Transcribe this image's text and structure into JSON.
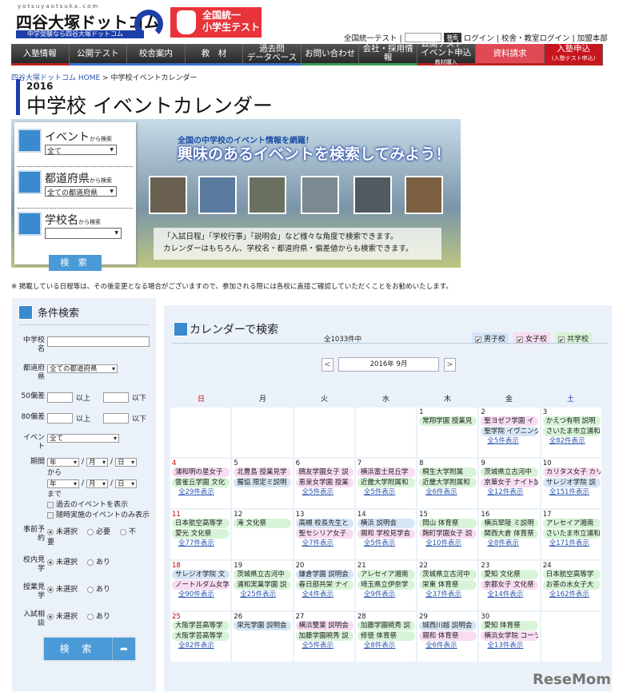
{
  "header": {
    "logo_url": "yotsuyaotsuka.com",
    "logo_text": "四谷大塚ドットコム",
    "logo_tagline": "中学受験なら四谷大塚ドットコム",
    "banner": "全国統一小学生テスト",
    "banner_l1": "全国統一",
    "banner_l2": "小学生テスト",
    "toplinks": {
      "test": "全国統一テスト | ",
      "search_button": "検索",
      "login": "ログイン | 校舎・教室ログイン | 加盟本部"
    }
  },
  "nav": [
    {
      "label": "入塾情報"
    },
    {
      "label": "公開テスト"
    },
    {
      "label": "校舎案内"
    },
    {
      "label": "教　材"
    },
    {
      "label": "過去問",
      "sub": "データベース"
    },
    {
      "label": "お問い合わせ"
    },
    {
      "label": "会社・採用情報"
    },
    {
      "label": "公開テスト・イベント申込",
      "sub": "教材購入"
    },
    {
      "label": "資料請求"
    },
    {
      "label": "入塾申込",
      "sub": "(入塾テスト申込)"
    }
  ],
  "breadcrumb": {
    "home": "四谷大塚ドットコム HOME",
    "sep": ">",
    "current": "中学校イベントカレンダー"
  },
  "title": {
    "year": "2016",
    "main": "中学校 イベントカレンダー"
  },
  "quick_search": {
    "event_label": "イベント",
    "event_suffix": "から検索",
    "event_value": "全て",
    "pref_label": "都道府県",
    "pref_suffix": "から検索",
    "pref_value": "全ての都道府県",
    "school_label": "学校名",
    "school_suffix": "から検索",
    "school_value": "",
    "button": "検 索"
  },
  "hero": {
    "lead": "全国の中学校のイベント情報を網羅！",
    "headline": "興味のあるイベントを検索してみよう！",
    "note1": "「入試日程」「学校行事」「説明会」など様々な角度で検索できます。",
    "note2": "カレンダーはもちろん、学校名・都道府県・偏差値からも検索できます。"
  },
  "notice": "※ 掲載している日程等は、その後変更となる場合がございますので、参加される際には各校に直接ご確認していただくことをお勧めいたします。",
  "sidebar": {
    "title": "条件検索",
    "school_name_label": "中学校名",
    "school_name_value": "",
    "pref_label": "都道府県",
    "pref_value": "全ての都道府県",
    "dev50_label": "50偏差",
    "dev80_label": "80偏差",
    "above": "以上",
    "below": "以下",
    "event_label": "イベント",
    "event_value": "全て",
    "period_label": "期間",
    "year": "年",
    "month": "月",
    "day": "日",
    "slash": "/",
    "from": "から",
    "until": "まで",
    "past_events": "過去のイベントを表示",
    "anytime_only": "随時実施のイベントのみ表示",
    "radios": [
      {
        "label": "事前予約",
        "options": [
          "未選択",
          "必要",
          "不要"
        ]
      },
      {
        "label": "校内見学",
        "options": [
          "未選択",
          "あり"
        ]
      },
      {
        "label": "授業見学",
        "options": [
          "未選択",
          "あり"
        ]
      },
      {
        "label": "入試相談",
        "options": [
          "未選択",
          "あり"
        ]
      }
    ],
    "button": "検 索"
  },
  "calendar": {
    "title": "カレンダーで検索",
    "count": "全1033件中",
    "filters": [
      {
        "label": "男子校",
        "checked": true,
        "color": "#d6e6f6"
      },
      {
        "label": "女子校",
        "checked": true,
        "color": "#f8dcf2"
      },
      {
        "label": "共学校",
        "checked": true,
        "color": "#d8f4d8"
      }
    ],
    "prev": "<",
    "next": ">",
    "month": "2016年 9月",
    "weekdays": [
      "日",
      "月",
      "火",
      "水",
      "木",
      "金",
      "土"
    ],
    "days": [
      {
        "day": "",
        "events": []
      },
      {
        "day": "",
        "events": []
      },
      {
        "day": "",
        "events": []
      },
      {
        "day": "",
        "events": []
      },
      {
        "day": "1",
        "events": [
          {
            "name": "常翔学園 授業見",
            "type": "coed"
          }
        ]
      },
      {
        "day": "2",
        "events": [
          {
            "name": "聖ヨゼフ学園 イ",
            "type": "girl"
          },
          {
            "name": "聖学院 イヴニング",
            "type": "boy"
          }
        ],
        "more": "全5件表示"
      },
      {
        "day": "3",
        "events": [
          {
            "name": "かえつ有明 説明",
            "type": "coed"
          },
          {
            "name": "さいたま市立浦和",
            "type": "coed"
          }
        ],
        "more": "全82件表示"
      },
      {
        "day": "4",
        "events": [
          {
            "name": "浦和明の星女子",
            "type": "girl"
          },
          {
            "name": "雲雀丘学園 文化",
            "type": "coed"
          }
        ],
        "more": "全29件表示"
      },
      {
        "day": "5",
        "events": [
          {
            "name": "北豊島 授業見学",
            "type": "girl"
          },
          {
            "name": "獨協 限定ミ説明",
            "type": "boy"
          }
        ]
      },
      {
        "day": "6",
        "events": [
          {
            "name": "鴎友学園女子 説",
            "type": "girl"
          },
          {
            "name": "恵泉女学園 授業",
            "type": "girl"
          }
        ],
        "more": "全5件表示"
      },
      {
        "day": "7",
        "events": [
          {
            "name": "横浜富士見丘学",
            "type": "girl"
          },
          {
            "name": "近畿大学附属和",
            "type": "coed"
          }
        ],
        "more": "全5件表示"
      },
      {
        "day": "8",
        "events": [
          {
            "name": "桐生大学附属",
            "type": "coed"
          },
          {
            "name": "近畿大学附属和",
            "type": "coed"
          }
        ],
        "more": "全6件表示"
      },
      {
        "day": "9",
        "events": [
          {
            "name": "茨城県立古河中",
            "type": "coed"
          },
          {
            "name": "京華女子 ナイト説",
            "type": "girl"
          }
        ],
        "more": "全12件表示"
      },
      {
        "day": "10",
        "events": [
          {
            "name": "カリタス女子 カリ",
            "type": "girl"
          },
          {
            "name": "サレジオ学院 説",
            "type": "boy"
          }
        ],
        "more": "全151件表示"
      },
      {
        "day": "11",
        "events": [
          {
            "name": "日本航空高等学",
            "type": "coed"
          },
          {
            "name": "愛光 文化祭",
            "type": "coed"
          }
        ],
        "more": "全77件表示"
      },
      {
        "day": "12",
        "events": [
          {
            "name": "滝 文化祭",
            "type": "coed"
          }
        ]
      },
      {
        "day": "13",
        "events": [
          {
            "name": "高槻 校長先生と",
            "type": "boy"
          },
          {
            "name": "聖セシリア女子",
            "type": "girl"
          }
        ],
        "more": "全7件表示"
      },
      {
        "day": "14",
        "events": [
          {
            "name": "横浜 説明会",
            "type": "boy"
          },
          {
            "name": "親和 学校見学会",
            "type": "girl"
          }
        ],
        "more": "全5件表示"
      },
      {
        "day": "15",
        "events": [
          {
            "name": "岡山 体育祭",
            "type": "coed"
          },
          {
            "name": "麹町学園女子 説",
            "type": "girl"
          }
        ],
        "more": "全10件表示"
      },
      {
        "day": "16",
        "events": [
          {
            "name": "横浜翠陵 ミ説明",
            "type": "coed"
          },
          {
            "name": "関西大倉 体育祭",
            "type": "coed"
          }
        ],
        "more": "全8件表示"
      },
      {
        "day": "17",
        "events": [
          {
            "name": "アレセイア湘南",
            "type": "coed"
          },
          {
            "name": "さいたま市立浦和",
            "type": "coed"
          }
        ],
        "more": "全171件表示"
      },
      {
        "day": "18",
        "events": [
          {
            "name": "サレジオ学院 文",
            "type": "boy"
          },
          {
            "name": "ノートルダム女学",
            "type": "girl"
          }
        ],
        "more": "全90件表示"
      },
      {
        "day": "19",
        "events": [
          {
            "name": "茨城県立古河中",
            "type": "coed"
          },
          {
            "name": "浦和実業学園 説",
            "type": "coed"
          }
        ],
        "more": "全25件表示"
      },
      {
        "day": "20",
        "events": [
          {
            "name": "鎌倉学園 説明会",
            "type": "boy"
          },
          {
            "name": "春日部共栄 ナイ",
            "type": "coed"
          }
        ],
        "more": "全4件表示"
      },
      {
        "day": "21",
        "events": [
          {
            "name": "アレセイア湘南",
            "type": "coed"
          },
          {
            "name": "埼玉県立伊奈学",
            "type": "coed"
          }
        ],
        "more": "全9件表示"
      },
      {
        "day": "22",
        "events": [
          {
            "name": "茨城県立古河中",
            "type": "coed"
          },
          {
            "name": "栄東 体育祭",
            "type": "coed"
          }
        ],
        "more": "全37件表示"
      },
      {
        "day": "23",
        "events": [
          {
            "name": "愛知 文化祭",
            "type": "coed"
          },
          {
            "name": "京都女子 文化祭",
            "type": "girl"
          }
        ],
        "more": "全14件表示"
      },
      {
        "day": "24",
        "events": [
          {
            "name": "日本航空高等学",
            "type": "coed"
          },
          {
            "name": "お茶の水女子大",
            "type": "coed"
          }
        ],
        "more": "全162件表示"
      },
      {
        "day": "25",
        "events": [
          {
            "name": "大阪学芸高等学",
            "type": "coed"
          },
          {
            "name": "大阪学芸高等学",
            "type": "coed"
          }
        ],
        "more": "全82件表示"
      },
      {
        "day": "26",
        "events": [
          {
            "name": "栄光学園 説明会",
            "type": "boy"
          }
        ]
      },
      {
        "day": "27",
        "events": [
          {
            "name": "横浜雙葉 説明会",
            "type": "girl"
          },
          {
            "name": "加藤学園暁秀 説",
            "type": "coed"
          }
        ],
        "more": "全5件表示"
      },
      {
        "day": "28",
        "events": [
          {
            "name": "加藤学園暁秀 説",
            "type": "coed"
          },
          {
            "name": "修徳 体育祭",
            "type": "coed"
          }
        ],
        "more": "全8件表示"
      },
      {
        "day": "29",
        "events": [
          {
            "name": "城西川越 説明会",
            "type": "boy"
          },
          {
            "name": "親和 体育祭",
            "type": "girl"
          }
        ],
        "more": "全6件表示"
      },
      {
        "day": "30",
        "events": [
          {
            "name": "愛知 体育祭",
            "type": "coed"
          },
          {
            "name": "横浜女学院 コーラ",
            "type": "girl"
          }
        ],
        "more": "全13件表示"
      },
      {
        "day": "",
        "events": []
      }
    ]
  },
  "watermark": "ReseMom"
}
